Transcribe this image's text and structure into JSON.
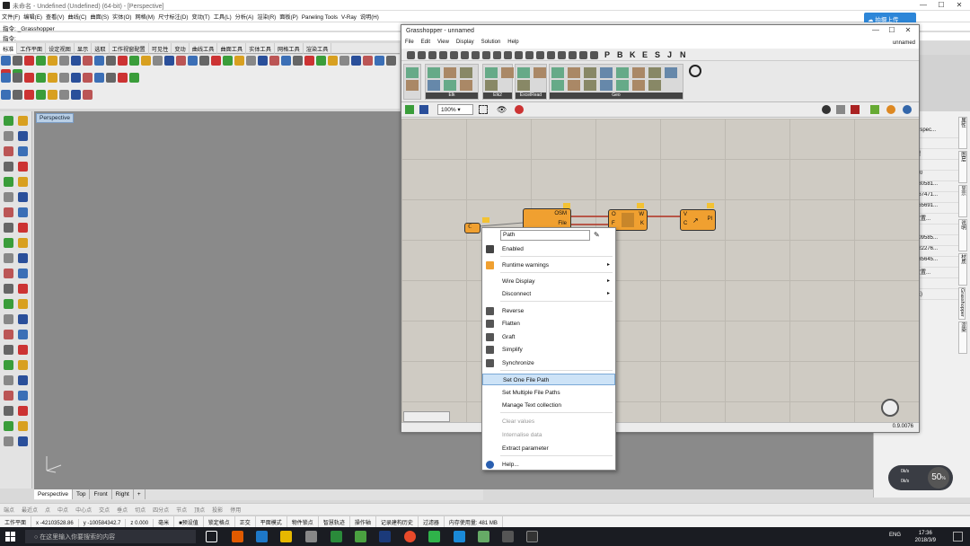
{
  "rhino": {
    "title": "未命名 - Undefined (Undefined) (64-bit) - [Perspective]",
    "menu": [
      "文件(F)",
      "编辑(E)",
      "查看(V)",
      "曲线(C)",
      "曲面(S)",
      "实体(O)",
      "网格(M)",
      "尺寸标注(D)",
      "变动(T)",
      "工具(L)",
      "分析(A)",
      "渲染(R)",
      "面板(P)",
      "Paneling Tools",
      "V-Ray",
      "说明(H)"
    ],
    "cmd_history": "指令: _Grasshopper",
    "cmd_prompt": "指令:",
    "tabs": [
      "标准",
      "工作平面",
      "设定视图",
      "显示",
      "选取",
      "工作视窗配置",
      "可见性",
      "变动",
      "曲线工具",
      "曲面工具",
      "实体工具",
      "网格工具",
      "渲染工具"
    ],
    "viewport_label": "Perspective",
    "viewport_tabs": [
      "Perspective",
      "Top",
      "Front",
      "Right"
    ],
    "osnaps": [
      "端点",
      "最近点",
      "点",
      "中点",
      "中心点",
      "交点",
      "垂点",
      "切点",
      "四分点",
      "节点",
      "顶点",
      "投影",
      "停用"
    ],
    "status": [
      "工作平面",
      "x -42103528.86",
      "y -100584342.7",
      "z 0.000",
      "毫米",
      "■预设值",
      "锁定格点",
      "正交",
      "平面模式",
      "物件锁点",
      "智慧轨迹",
      "操作轴",
      "记录建构历史",
      "过滤器",
      "内存使用量: 481 MB"
    ],
    "right_panel": [
      "erspec...",
      "",
      "视",
      "",
      "5.0",
      "180581...",
      "367471...",
      "265691...",
      "放置...",
      "",
      "109585...",
      "822276...",
      "335645...",
      "放置...",
      "",
      "无)"
    ],
    "right_tabs": [
      "属性",
      "图层",
      "显示",
      "说明",
      "材质",
      "Grasshopper",
      "渲染"
    ],
    "cloud_btn": "拍摄上传",
    "speed": "50",
    "speed_unit": "%",
    "up_speed": "0k/s",
    "down_speed": "0k/s"
  },
  "taskbar": {
    "search": "在这里输入你要搜索的内容",
    "ime": "ENG",
    "time": "17:36",
    "date": "2018/3/9"
  },
  "gh": {
    "title": "Grasshopper - unnamed",
    "menu": [
      "File",
      "Edit",
      "View",
      "Display",
      "Solution",
      "Help"
    ],
    "doc": "unnamed",
    "tabs": [
      "P",
      "B",
      "K",
      "E",
      "S",
      "J",
      "N"
    ],
    "groups": [
      "Elk",
      "Elk2",
      "ExcelRead",
      "Geo"
    ],
    "zoom": "100%",
    "status": "0.9.0076",
    "components": {
      "path_param": "ℂ",
      "osm": {
        "out1": "OSM",
        "out2": "File"
      },
      "elk": {
        "l1": "O",
        "l2": "F",
        "r1": "W",
        "r2": "K"
      },
      "pl": {
        "l1": "V",
        "l2": "C",
        "r": "Pl"
      }
    }
  },
  "context_menu": {
    "path_value": "Path",
    "items": [
      {
        "label": "Enabled",
        "icon": "checkbox-icon",
        "dis": false
      },
      {
        "label": "Runtime warnings",
        "icon": "warning-icon",
        "arrow": "▸"
      },
      {
        "label": "Wire Display",
        "arrow": "▸"
      },
      {
        "label": "Disconnect",
        "arrow": "▸"
      },
      {
        "label": "Reverse",
        "icon": "reverse-icon"
      },
      {
        "label": "Flatten",
        "icon": "flatten-icon"
      },
      {
        "label": "Graft",
        "icon": "graft-icon"
      },
      {
        "label": "Simplify",
        "icon": "simplify-icon"
      },
      {
        "label": "Synchronize",
        "icon": "sync-icon"
      },
      {
        "label": "Set One File Path",
        "hl": true
      },
      {
        "label": "Set Multiple File Paths"
      },
      {
        "label": "Manage Text collection"
      },
      {
        "label": "Clear values",
        "dis": true
      },
      {
        "label": "Internalise data",
        "dis": true
      },
      {
        "label": "Extract parameter"
      },
      {
        "label": "Help...",
        "icon": "help-icon"
      }
    ]
  }
}
